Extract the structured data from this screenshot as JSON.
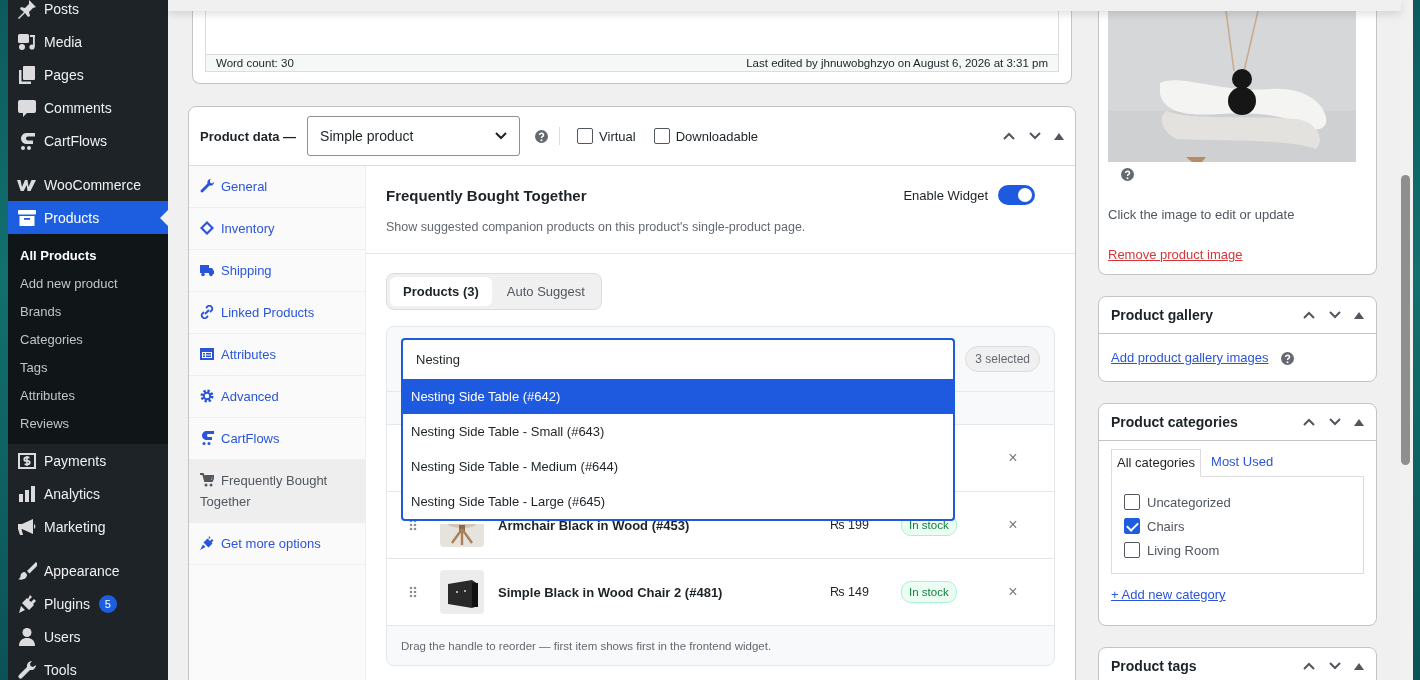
{
  "admin_menu": {
    "groups": [
      {
        "items": [
          {
            "label": "Posts",
            "selected": false
          },
          {
            "label": "Media",
            "selected": false
          },
          {
            "label": "Pages",
            "selected": false
          },
          {
            "label": "Comments",
            "selected": false
          },
          {
            "label": "CartFlows",
            "selected": false
          }
        ]
      },
      {
        "items": [
          {
            "label": "WooCommerce",
            "selected": false
          },
          {
            "label": "Products",
            "selected": true,
            "children": [
              {
                "label": "All Products",
                "selected": true
              },
              {
                "label": "Add new product",
                "selected": false
              },
              {
                "label": "Brands",
                "selected": false
              },
              {
                "label": "Categories",
                "selected": false
              },
              {
                "label": "Tags",
                "selected": false
              },
              {
                "label": "Attributes",
                "selected": false
              },
              {
                "label": "Reviews",
                "selected": false
              }
            ]
          },
          {
            "label": "Payments",
            "selected": false
          },
          {
            "label": "Analytics",
            "selected": false
          },
          {
            "label": "Marketing",
            "selected": false
          }
        ]
      },
      {
        "items": [
          {
            "label": "Appearance",
            "selected": false
          },
          {
            "label": "Plugins",
            "selected": false,
            "badge": "5"
          },
          {
            "label": "Users",
            "selected": false
          },
          {
            "label": "Tools",
            "selected": false
          }
        ]
      }
    ]
  },
  "editor": {
    "word_count": "Word count: 30",
    "last_edited": "Last edited by jhnuwobghzyo on August 6, 2026 at 3:31 pm"
  },
  "product_data": {
    "title": "Product data —",
    "product_type": "Simple product",
    "options": [
      {
        "label": "Virtual",
        "checked": false
      },
      {
        "label": "Downloadable",
        "checked": false
      }
    ],
    "tabs": [
      {
        "label": "General",
        "selected": false
      },
      {
        "label": "Inventory",
        "selected": false
      },
      {
        "label": "Shipping",
        "selected": false
      },
      {
        "label": "Linked Products",
        "selected": false
      },
      {
        "label": "Attributes",
        "selected": false
      },
      {
        "label": "Advanced",
        "selected": false
      },
      {
        "label": "CartFlows",
        "selected": false
      },
      {
        "label": "Frequently Bought Together",
        "selected": true
      },
      {
        "label": "Get more options",
        "selected": false
      }
    ],
    "panel": {
      "title": "Frequently Bought Together",
      "enable_widget": {
        "label": "Enable Widget",
        "on": true
      },
      "description": "Show suggested companion products on this product's single-product page.",
      "segments": [
        {
          "label": "Products (3)",
          "selected": true
        },
        {
          "label": "Auto Suggest",
          "selected": false
        }
      ],
      "search_value": "Nesting",
      "selected_count": "3 selected",
      "suggestions": [
        {
          "label": "Nesting Side Table (#642)",
          "selected": true
        },
        {
          "label": "Nesting Side Table - Small (#643)",
          "selected": false
        },
        {
          "label": "Nesting Side Table - Medium (#644)",
          "selected": false
        },
        {
          "label": "Nesting Side Table - Large (#645)",
          "selected": false
        }
      ],
      "rows": [
        {
          "remove": "×"
        },
        {
          "name": "Armchair Black in Wood (#453)",
          "price": "₨ 199",
          "stock": "In stock",
          "remove": "×"
        },
        {
          "name": "Simple Black in Wood Chair 2 (#481)",
          "price": "₨ 149",
          "stock": "In stock",
          "remove": "×"
        }
      ],
      "footer_note": "Drag the handle to reorder — first item shows first in the frontend widget."
    }
  },
  "sidebar": {
    "product_image": {
      "hint": "Click the image to edit or update",
      "remove_link": "Remove product image"
    },
    "product_gallery": {
      "title": "Product gallery",
      "add_link": "Add product gallery images"
    },
    "product_categories": {
      "title": "Product categories",
      "tabs": [
        {
          "label": "All categories",
          "selected": true
        },
        {
          "label": "Most Used",
          "selected": false
        }
      ],
      "items": [
        {
          "label": "Uncategorized",
          "checked": false
        },
        {
          "label": "Chairs",
          "checked": true
        },
        {
          "label": "Living Room",
          "checked": false
        }
      ],
      "add_link": "+ Add new category"
    },
    "product_tags": {
      "title": "Product tags"
    }
  }
}
